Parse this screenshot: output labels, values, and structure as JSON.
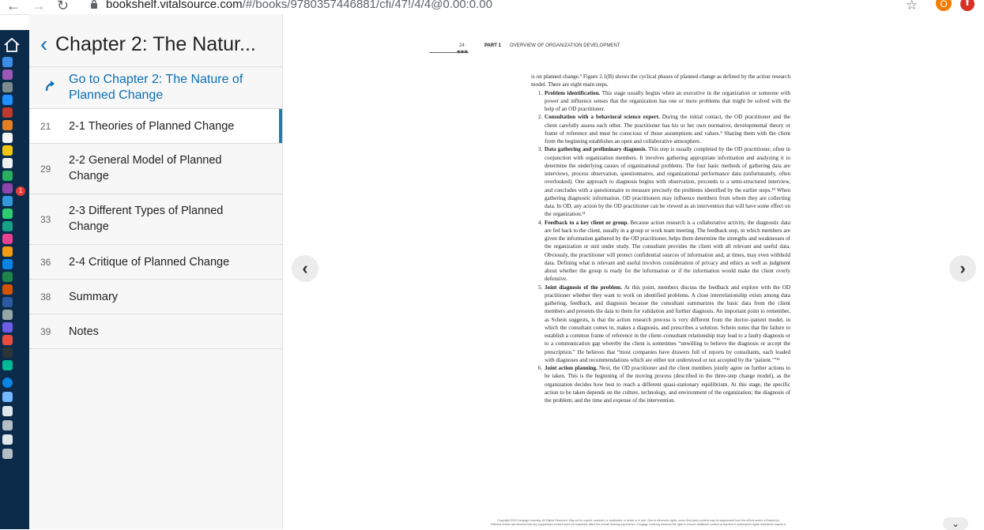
{
  "browser": {
    "url_host": "bookshelf.vitalsource.com",
    "url_path": "/#/books/9780357446881/cfi/47!/4/4@0.00:0.00",
    "ext1_label": "O",
    "ext2_label": "⬆"
  },
  "sidebar": {
    "title": "Chapter 2: The Natur...",
    "goto_label": "Go to Chapter 2: The Nature of Planned Change",
    "items": [
      {
        "num": "21",
        "label": "2-1 Theories of Planned Change"
      },
      {
        "num": "29",
        "label": "2-2 General Model of Planned Change"
      },
      {
        "num": "33",
        "label": "2-3 Different Types of Planned Change"
      },
      {
        "num": "36",
        "label": "2-4 Critique of Planned Change"
      },
      {
        "num": "38",
        "label": "Summary"
      },
      {
        "num": "39",
        "label": "Notes"
      }
    ]
  },
  "dock": {
    "badge": "1"
  },
  "page": {
    "number": "24",
    "part": "PART 1",
    "part_title": "OVERVIEW OF ORGANIZATION DEVELOPMENT",
    "intro": "is on planned change.⁹ Figure 2.1(B) shows the cyclical phases of planned change as defined by the action research model. There are eight main steps.",
    "steps": [
      {
        "title": "Problem identification.",
        "body": " This stage usually begins when an executive in the organization or someone with power and influence senses that the organization has one or more problems that might be solved with the help of an OD practitioner."
      },
      {
        "title": "Consultation with a behavioral science expert.",
        "body": " During the initial contact, the OD practitioner and the client carefully assess each other. The practitioner has his or her own normative, developmental theory or frame of reference and must be conscious of those assumptions and values.⁹ Sharing them with the client from the beginning establishes an open and collaborative atmosphere."
      },
      {
        "title": "Data gathering and preliminary diagnosis.",
        "body": " This step is usually completed by the OD practitioner, often in conjunction with organization members. It involves gathering appropriate information and analyzing it to determine the underlying causes of organizational problems. The four basic methods of gathering data are interviews, process observation, questionnaires, and organizational performance data (unfortunately, often overlooked). One approach to diagnosis begins with observation, proceeds to a semi-structured interview, and concludes with a questionnaire to measure precisely the problems identified by the earlier steps.¹⁰ When gathering diagnostic information, OD practitioners may influence members from whom they are collecting data. In OD, any action by the OD practitioner can be viewed as an intervention that will have some effect on the organization.¹¹"
      },
      {
        "title": "Feedback to a key client or group.",
        "body": " Because action research is a collaborative activity, the diagnostic data are fed back to the client, usually in a group or work team meeting. The feedback step, in which members are given the information gathered by the OD practitioner, helps them determine the strengths and weaknesses of the organization or unit under study. The consultant provides the client with all relevant and useful data. Obviously, the practitioner will protect confidential sources of information and, at times, may even withhold data. Defining what is relevant and useful involves consideration of privacy and ethics as well as judgment about whether the group is ready for the information or if the information would make the client overly defensive."
      },
      {
        "title": "Joint diagnosis of the problem.",
        "body": " At this point, members discuss the feedback and explore with the OD practitioner whether they want to work on identified problems. A close interrelationship exists among data gathering, feedback, and diagnosis because the consultant summarizes the basic data from the client members and presents the data to them for validation and further diagnosis. An important point to remember, as Schein suggests, is that the action research process is very different from the doctor–patient model, in which the consultant comes in, makes a diagnosis, and prescribes a solution. Schein notes that the failure to establish a common frame of reference in the client–consultant relationship may lead to a faulty diagnosis or to a communication gap whereby the client is sometimes “unwilling to believe the diagnosis or accept the prescription.” He believes that “most companies have drawers full of reports by consultants, each loaded with diagnoses and recommendations which are either not understood or not accepted by the ‘patient.’”¹²"
      },
      {
        "title": "Joint action planning.",
        "body": " Next, the OD practitioner and the client members jointly agree on further actions to be taken. This is the beginning of the moving process (described in the three-step change model), as the organization decides how best to reach a different quasi-stationary equilibrium. At this stage, the specific action to be taken depends on the culture, technology, and environment of the organization; the diagnosis of the problem; and the time and expense of the intervention."
      }
    ],
    "footer_line1": "Copyright 2019 Cengage Learning. All Rights Reserved. May not be copied, scanned, or duplicated, in whole or in part. Due to electronic rights, some third party content may be suppressed from the eBook and/or eChapter(s).",
    "footer_line2": "Editorial review has deemed that any suppressed content does not materially affect the overall learning experience. Cengage Learning reserves the right to remove additional content at any time if subsequent rights restrictions require it."
  }
}
